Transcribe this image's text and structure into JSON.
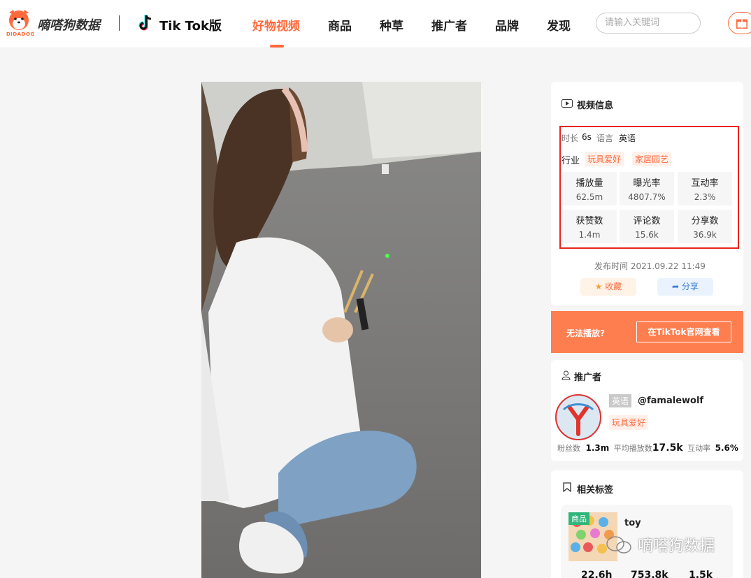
{
  "header": {
    "logo_text": "嘀嗒狗数据",
    "logo_sub": "DIDADOG",
    "platform": "Tik Tok版",
    "nav": [
      "好物视频",
      "商品",
      "种草",
      "推广者",
      "品牌",
      "发现"
    ],
    "active_nav": "好物视频",
    "search_placeholder": "请输入关键词"
  },
  "video_info": {
    "title": "视频信息",
    "duration_label": "时长",
    "duration": "6s",
    "language_label": "语言",
    "language": "英语",
    "industry_label": "行业",
    "industry_tags": [
      "玩具爱好",
      "家居园艺"
    ],
    "stats": [
      {
        "label": "播放量",
        "value": "62.5m"
      },
      {
        "label": "曝光率",
        "value": "4807.7%"
      },
      {
        "label": "互动率",
        "value": "2.3%"
      },
      {
        "label": "获赞数",
        "value": "1.4m"
      },
      {
        "label": "评论数",
        "value": "15.6k"
      },
      {
        "label": "分享数",
        "value": "36.9k"
      }
    ],
    "publish_time": "发布时间 2021.09.22 11:49",
    "collect_label": "收藏",
    "share_label": "分享"
  },
  "cannot_play": {
    "text": "无法播放?",
    "button": "在TikTok官网查看"
  },
  "promoter": {
    "title": "推广者",
    "lang_tag": "英语",
    "handle": "@famalewolf",
    "category_tag": "玩具爱好",
    "followers_label": "粉丝数",
    "followers": "1.3m",
    "avg_play_label": "平均播放数",
    "avg_play": "17.5k",
    "engagement_label": "互动率",
    "engagement": "5.6%"
  },
  "related_tags": {
    "title": "相关标签",
    "badge": "商品",
    "name": "toy",
    "numbers": [
      "22.6h",
      "753.8k",
      "1.5k"
    ]
  },
  "watermark": "嘀嗒狗数据",
  "colors": {
    "accent": "#ff6a3d",
    "highlight_box": "#e8231b",
    "bar": "#ff7e50"
  }
}
